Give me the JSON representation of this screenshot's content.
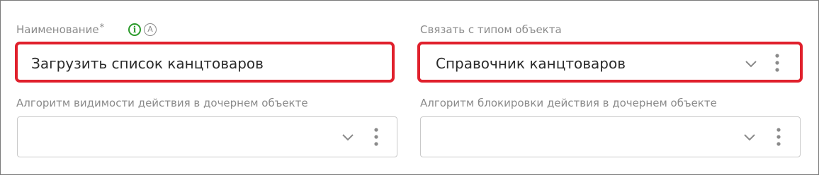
{
  "form": {
    "name_field": {
      "label": "Наименование",
      "required_mark": "*",
      "info_icon_glyph": "i",
      "auto_icon_glyph": "A",
      "value": "Загрузить список канцтоваров"
    },
    "object_type_field": {
      "label": "Связать с типом объекта",
      "value": "Справочник канцтоваров"
    },
    "visibility_algorithm_field": {
      "label": "Алгоритм видимости действия в дочернем объекте",
      "value": ""
    },
    "lock_algorithm_field": {
      "label": "Алгоритм блокировки действия в дочернем объекте",
      "value": ""
    }
  },
  "icons": {
    "info": "info-circle-icon",
    "auto": "auto-letter-icon",
    "chevron": "chevron-down-icon",
    "more": "more-vertical-icon"
  },
  "colors": {
    "highlight": "#e0202c",
    "info_green": "#2a9a2a",
    "label_gray": "#8a8a8a",
    "border_gray": "#c9c9c9",
    "text": "#2b2b2b"
  }
}
